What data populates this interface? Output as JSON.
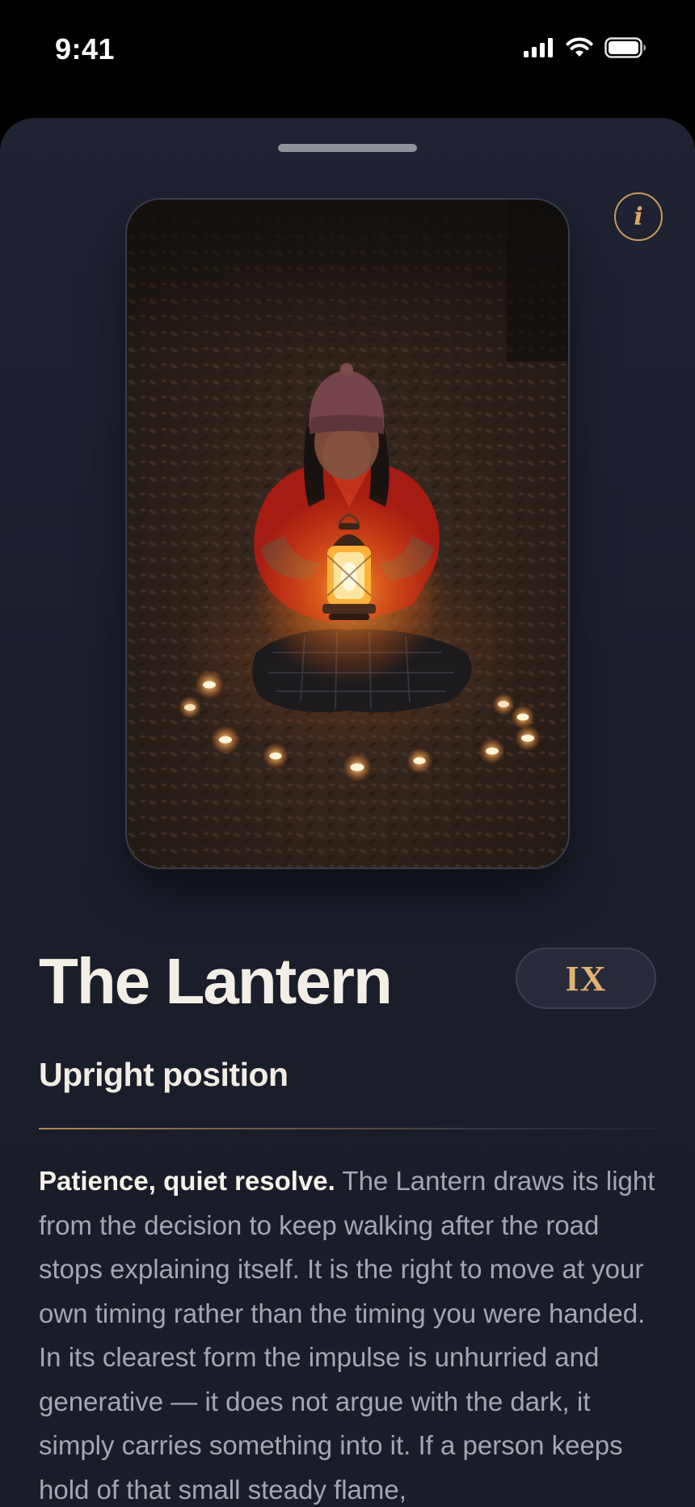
{
  "status_bar": {
    "time": "9:41",
    "icons": [
      "signal-icon",
      "wifi-icon",
      "battery-icon"
    ]
  },
  "sheet": {
    "info_icon": "i",
    "card": {
      "image": "woman-holding-lantern-among-candles-in-dark-forest"
    },
    "title": "The Lantern",
    "numeral": "IX",
    "subtitle": "Upright position",
    "description": {
      "lead": "Patience, quiet resolve.",
      "text": "The Lantern draws its light from the decision to keep walking after the road stops explaining itself. It is the right to move at your own timing rather than the timing you were handed. In its clearest form the impulse is unhurried and generative — it does not argue with the dark, it simply carries something into it. If a person keeps hold of that small steady flame,"
    }
  },
  "colors": {
    "accent": "#c89a5e",
    "numeral": "#e1b175",
    "sheet_bg": "#1c1f2c",
    "title": "#f3efe6",
    "body": "#a3a6b4"
  }
}
